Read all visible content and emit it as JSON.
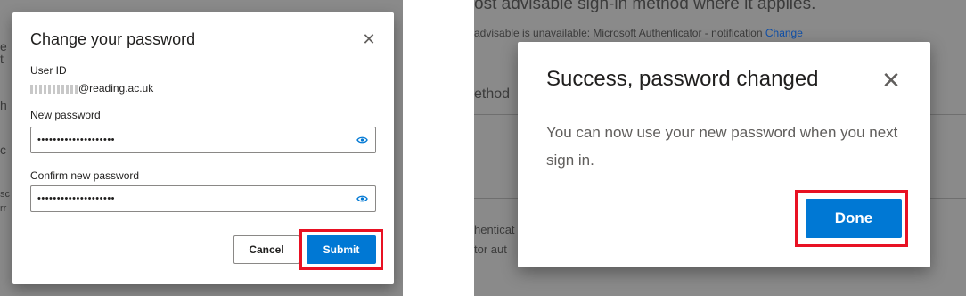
{
  "left_dialog": {
    "title": "Change your password",
    "close_icon": "close-icon",
    "user_id_label": "User ID",
    "user_id_value": "@reading.ac.uk",
    "new_password_label": "New password",
    "new_password_value": "••••••••••••••••••••",
    "confirm_password_label": "Confirm new password",
    "confirm_password_value": "••••••••••••••••••••",
    "reveal_icon": "eye-icon",
    "cancel_label": "Cancel",
    "submit_label": "Submit"
  },
  "left_background": {
    "fragments": [
      "e",
      "t",
      "h",
      "c",
      "sc",
      "rr"
    ]
  },
  "right_background": {
    "line1": "ost advisable sign-in method where it applies.",
    "line2": "advisable is unavailable: Microsoft Authenticator - notification",
    "change_link": "Change",
    "method_heading": "ethod",
    "auth1": "henticat",
    "auth2": "tor aut"
  },
  "right_dialog": {
    "title": "Success, password changed",
    "close_icon": "close-icon",
    "message": "You can now use your new password when you next sign in.",
    "done_label": "Done"
  },
  "colors": {
    "primary": "#0078d4",
    "highlight": "#e81123",
    "overlay": "#8a8a8a",
    "link": "#0f4fa8"
  }
}
